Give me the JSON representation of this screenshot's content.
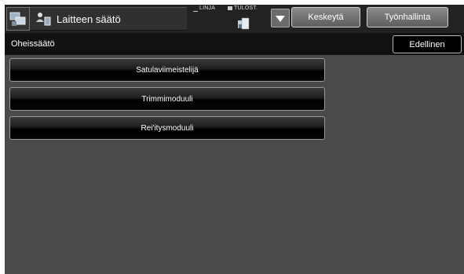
{
  "header": {
    "title": "Laitteen säätö",
    "app_icon": "machine-settings-icon",
    "title_icon": "user-settings-icon",
    "status_linja": "LINJA",
    "status_tulost": "TULOST.",
    "stop_label": "Keskeytä",
    "job_status_label": "Työnhallinta"
  },
  "subheader": {
    "title": "Oheissäätö",
    "back_label": "Edellinen"
  },
  "menu": {
    "items": [
      {
        "label": "Satulaviimeistelijä"
      },
      {
        "label": "Trimmimoduuli"
      },
      {
        "label": "Rei'itysmoduuli"
      }
    ]
  },
  "colors": {
    "screen_bg": "#4a4a4a",
    "topbar_bg": "#222222",
    "subbar_bg": "#111111"
  }
}
